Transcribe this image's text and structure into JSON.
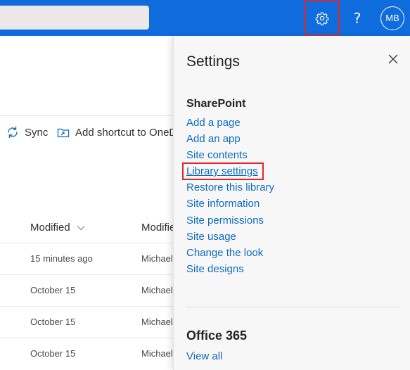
{
  "topbar": {
    "search_value": "",
    "settings_icon": "gear-icon",
    "help_label": "?",
    "avatar_initials": "MB",
    "accent_color": "#0f6cdc"
  },
  "commandbar": {
    "sync_label": "Sync",
    "add_shortcut_label": "Add shortcut to OneD"
  },
  "list": {
    "columns": [
      "Modified",
      "Modifie"
    ],
    "rows": [
      {
        "modified": "15 minutes ago",
        "modified_by": "Michael"
      },
      {
        "modified": "October 15",
        "modified_by": "Michael"
      },
      {
        "modified": "October 15",
        "modified_by": "Michael"
      },
      {
        "modified": "October 15",
        "modified_by": "Michael"
      }
    ]
  },
  "settings_panel": {
    "title": "Settings",
    "close_icon": "close-icon",
    "sharepoint_heading": "SharePoint",
    "sharepoint_links": [
      "Add a page",
      "Add an app",
      "Site contents",
      "Library settings",
      "Restore this library",
      "Site information",
      "Site permissions",
      "Site usage",
      "Change the look",
      "Site designs"
    ],
    "office_heading": "Office 365",
    "office_links": [
      "View all"
    ],
    "highlight_color": "#e1262b"
  }
}
